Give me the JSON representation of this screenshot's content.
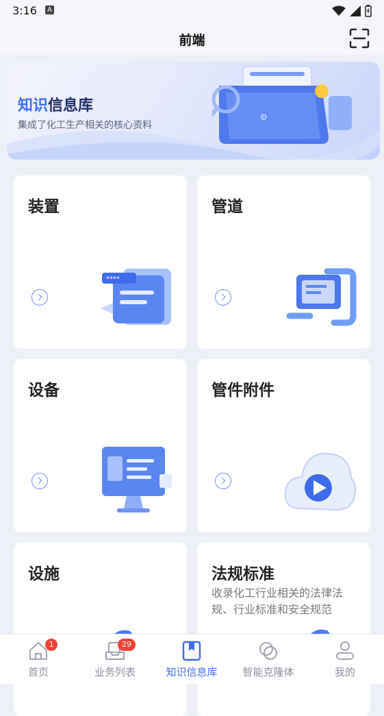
{
  "status": {
    "time": "3:16",
    "notification_glyph": "A"
  },
  "header": {
    "title": "前端",
    "scan_icon": "scan-icon"
  },
  "banner": {
    "title_part1": "知识",
    "title_part2": "信息库",
    "subtitle": "集成了化工生产相关的核心资料"
  },
  "cards": [
    {
      "title": "装置",
      "desc": ""
    },
    {
      "title": "管道",
      "desc": ""
    },
    {
      "title": "设备",
      "desc": ""
    },
    {
      "title": "管件附件",
      "desc": ""
    },
    {
      "title": "设施",
      "desc": ""
    },
    {
      "title": "法规标准",
      "desc": "收录化工行业相关的法律法规、行业标准和安全规范"
    }
  ],
  "tabbar": {
    "items": [
      {
        "label": "首页",
        "icon": "home-icon",
        "badge": "1"
      },
      {
        "label": "业务列表",
        "icon": "inbox-icon",
        "badge": "29"
      },
      {
        "label": "知识信息库",
        "icon": "book-icon",
        "badge": ""
      },
      {
        "label": "智能克隆体",
        "icon": "clone-icon",
        "badge": ""
      },
      {
        "label": "我的",
        "icon": "user-icon",
        "badge": ""
      }
    ],
    "active_index": 2
  },
  "colors": {
    "accent": "#3f6bea",
    "badge": "#f44336",
    "background": "#eef0f7"
  }
}
